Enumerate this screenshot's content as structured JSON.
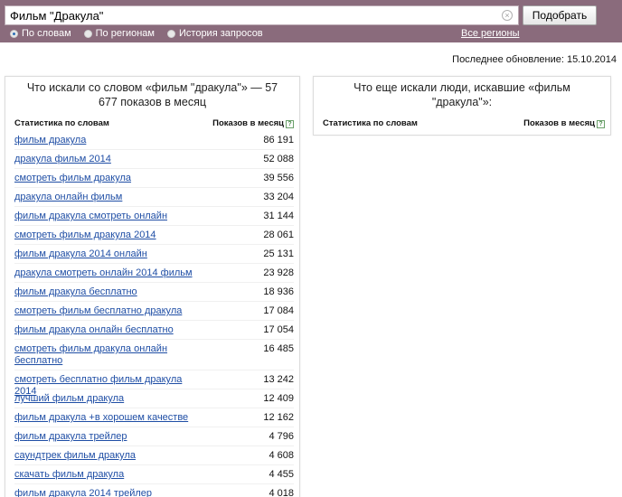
{
  "search": {
    "query": "Фильм \"Дракула\"",
    "submit_label": "Подобрать"
  },
  "modes": [
    {
      "label": "По словам",
      "checked": true
    },
    {
      "label": "По регионам",
      "checked": false
    },
    {
      "label": "История запросов",
      "checked": false
    }
  ],
  "regions_link": "Все регионы",
  "last_update": "Последнее обновление: 15.10.2014",
  "left_panel": {
    "title": "Что искали со словом «фильм \"дракула\"» — 57 677 показов в месяц",
    "col_phrase": "Статистика по словам",
    "col_count": "Показов в месяц",
    "rows": [
      {
        "phrase": "фильм дракула",
        "count": "86 191"
      },
      {
        "phrase": "дракула фильм 2014",
        "count": "52 088"
      },
      {
        "phrase": "смотреть фильм дракула",
        "count": "39 556"
      },
      {
        "phrase": "дракула онлайн фильм",
        "count": "33 204"
      },
      {
        "phrase": "фильм дракула смотреть онлайн",
        "count": "31 144"
      },
      {
        "phrase": "смотреть фильм дракула 2014",
        "count": "28 061"
      },
      {
        "phrase": "фильм дракула 2014 онлайн",
        "count": "25 131"
      },
      {
        "phrase": "дракула смотреть онлайн 2014 фильм",
        "count": "23 928"
      },
      {
        "phrase": "фильм дракула бесплатно",
        "count": "18 936"
      },
      {
        "phrase": "смотреть фильм бесплатно дракула",
        "count": "17 084"
      },
      {
        "phrase": "фильм дракула онлайн бесплатно",
        "count": "17 054"
      },
      {
        "phrase": "смотреть фильм дракула онлайн бесплатно",
        "count": "16 485"
      },
      {
        "phrase": "смотреть бесплатно фильм дракула 2014",
        "count": "13 242"
      },
      {
        "phrase": "лучший фильм дракула",
        "count": "12 409"
      },
      {
        "phrase": "фильм дракула +в хорошем качестве",
        "count": "12 162"
      },
      {
        "phrase": "фильм дракула трейлер",
        "count": "4 796"
      },
      {
        "phrase": "саундтрек фильм дракула",
        "count": "4 608"
      },
      {
        "phrase": "скачать фильм дракула",
        "count": "4 455"
      },
      {
        "phrase": "фильм дракула 2014 трейлер",
        "count": "4 018"
      }
    ]
  },
  "right_panel": {
    "title": "Что еще искали люди, искавшие «фильм \"дракула\"»:",
    "col_phrase": "Статистика по словам",
    "col_count": "Показов в месяц"
  },
  "colors": {
    "topbar": "#8a6b7c",
    "link": "#1f4ea5"
  }
}
